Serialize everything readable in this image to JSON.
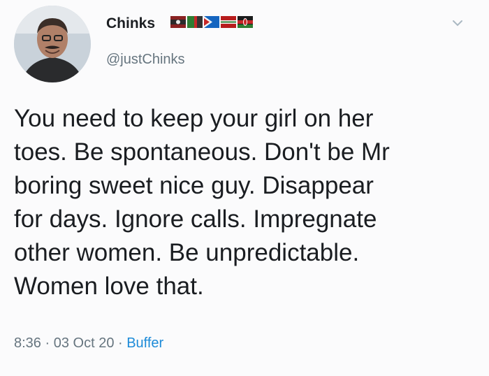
{
  "user": {
    "display_name": "Chinks",
    "handle": "@justChinks",
    "flags": [
      "flag-icon-1",
      "flag-icon-2",
      "flag-icon-3",
      "flag-icon-4",
      "flag-icon-5"
    ]
  },
  "tweet": {
    "lines": [
      "You need to keep your girl on her",
      "toes. Be spontaneous. Don't be Mr",
      "boring sweet nice guy. Disappear",
      "for days. Ignore calls. Impregnate",
      "other women. Be unpredictable.",
      "Women love that."
    ]
  },
  "meta": {
    "time": "8:36",
    "separator": " · ",
    "date": "03 Oct 20",
    "source": "Buffer"
  },
  "colors": {
    "handle": "#66757f",
    "source_link": "#1d8bd8"
  }
}
